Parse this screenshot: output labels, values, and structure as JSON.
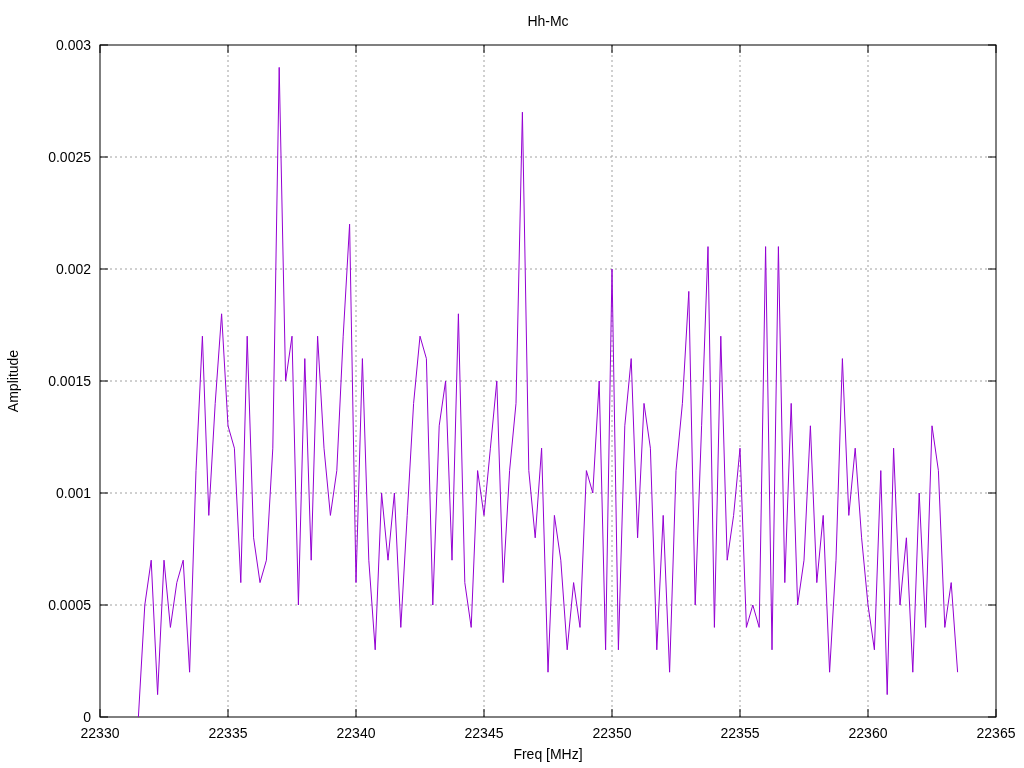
{
  "chart_data": {
    "type": "line",
    "title": "Hh-Mc",
    "xlabel": "Freq [MHz]",
    "ylabel": "Amplitude",
    "xlim": [
      22330,
      22365
    ],
    "ylim": [
      0,
      0.003
    ],
    "grid": true,
    "xticks": [
      22330,
      22335,
      22340,
      22345,
      22350,
      22355,
      22360,
      22365
    ],
    "yticks": [
      0,
      0.0005,
      0.001,
      0.0015,
      0.002,
      0.0025,
      0.003
    ],
    "x": [
      22331.5,
      22331.75,
      22332,
      22332.25,
      22332.5,
      22332.75,
      22333,
      22333.25,
      22333.5,
      22333.75,
      22334,
      22334.25,
      22334.5,
      22334.75,
      22335,
      22335.25,
      22335.5,
      22335.75,
      22336,
      22336.25,
      22336.5,
      22336.75,
      22337,
      22337.25,
      22337.5,
      22337.75,
      22338,
      22338.25,
      22338.5,
      22338.75,
      22339,
      22339.25,
      22339.5,
      22339.75,
      22340,
      22340.25,
      22340.5,
      22340.75,
      22341,
      22341.25,
      22341.5,
      22341.75,
      22342,
      22342.25,
      22342.5,
      22342.75,
      22343,
      22343.25,
      22343.5,
      22343.75,
      22344,
      22344.25,
      22344.5,
      22344.75,
      22345,
      22345.25,
      22345.5,
      22345.75,
      22346,
      22346.25,
      22346.5,
      22346.75,
      22347,
      22347.25,
      22347.5,
      22347.75,
      22348,
      22348.25,
      22348.5,
      22348.75,
      22349,
      22349.25,
      22349.5,
      22349.75,
      22350,
      22350.25,
      22350.5,
      22350.75,
      22351,
      22351.25,
      22351.5,
      22351.75,
      22352,
      22352.25,
      22352.5,
      22352.75,
      22353,
      22353.25,
      22353.5,
      22353.75,
      22354,
      22354.25,
      22354.5,
      22354.75,
      22355,
      22355.25,
      22355.5,
      22355.75,
      22356,
      22356.25,
      22356.5,
      22356.75,
      22357,
      22357.25,
      22357.5,
      22357.75,
      22358,
      22358.25,
      22358.5,
      22358.75,
      22359,
      22359.25,
      22359.5,
      22359.75,
      22360,
      22360.25,
      22360.5,
      22360.75,
      22361,
      22361.25,
      22361.5,
      22361.75,
      22362,
      22362.25,
      22362.5,
      22362.75,
      22363,
      22363.25,
      22363.5
    ],
    "series": [
      {
        "color": "#9400d3",
        "values": [
          0,
          0.0005,
          0.0007,
          0.0001,
          0.0007,
          0.0004,
          0.0006,
          0.0007,
          0.0002,
          0.0011,
          0.0017,
          0.0009,
          0.0014,
          0.0018,
          0.0013,
          0.0012,
          0.0006,
          0.0017,
          0.0008,
          0.0006,
          0.0007,
          0.0012,
          0.0029,
          0.0015,
          0.0017,
          0.0005,
          0.0016,
          0.0007,
          0.0017,
          0.0012,
          0.0009,
          0.0011,
          0.0017,
          0.0022,
          0.0006,
          0.0016,
          0.0007,
          0.0003,
          0.001,
          0.0007,
          0.001,
          0.0004,
          0.0009,
          0.0014,
          0.0017,
          0.0016,
          0.0005,
          0.0013,
          0.0015,
          0.0007,
          0.0018,
          0.0006,
          0.0004,
          0.0011,
          0.0009,
          0.0012,
          0.0015,
          0.0006,
          0.0011,
          0.0014,
          0.0027,
          0.0011,
          0.0008,
          0.0012,
          0.0002,
          0.0009,
          0.0007,
          0.0003,
          0.0006,
          0.0004,
          0.0011,
          0.001,
          0.0015,
          0.0003,
          0.002,
          0.0003,
          0.0013,
          0.0016,
          0.0008,
          0.0014,
          0.0012,
          0.0003,
          0.0009,
          0.0002,
          0.0011,
          0.0014,
          0.0019,
          0.0005,
          0.0013,
          0.0021,
          0.0004,
          0.0017,
          0.0007,
          0.0009,
          0.0012,
          0.0004,
          0.0005,
          0.0004,
          0.0021,
          0.0003,
          0.0021,
          0.0006,
          0.0014,
          0.0005,
          0.0007,
          0.0013,
          0.0006,
          0.0009,
          0.0002,
          0.0007,
          0.0016,
          0.0009,
          0.0012,
          0.0008,
          0.0005,
          0.0003,
          0.0011,
          0.0001,
          0.0012,
          0.0005,
          0.0008,
          0.0002,
          0.001,
          0.0004,
          0.0013,
          0.0011,
          0.0004,
          0.0006,
          0.0002
        ]
      }
    ]
  }
}
